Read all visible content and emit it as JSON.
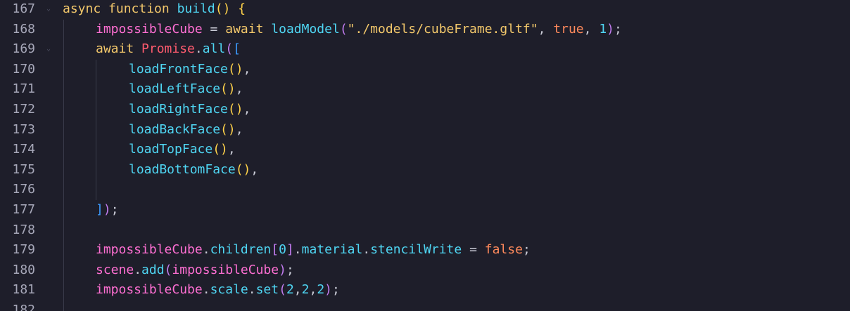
{
  "editor": {
    "lines": [
      {
        "num": "167",
        "tokens": [
          [
            "kw",
            "async"
          ],
          [
            "pn",
            " "
          ],
          [
            "kw",
            "function"
          ],
          [
            "pn",
            " "
          ],
          [
            "fn",
            "build"
          ],
          [
            "br1",
            "()"
          ],
          [
            "pn",
            " "
          ],
          [
            "br1",
            "{"
          ]
        ]
      },
      {
        "num": "168",
        "tokens": [
          [
            "var",
            "impossibleCube"
          ],
          [
            "pn",
            " = "
          ],
          [
            "kw",
            "await"
          ],
          [
            "pn",
            " "
          ],
          [
            "fn",
            "loadModel"
          ],
          [
            "br2",
            "("
          ],
          [
            "str",
            "\"./models/cubeFrame.gltf\""
          ],
          [
            "pn",
            ", "
          ],
          [
            "bool",
            "true"
          ],
          [
            "pn",
            ", "
          ],
          [
            "num",
            "1"
          ],
          [
            "br2",
            ")"
          ],
          [
            "pn",
            ";"
          ]
        ]
      },
      {
        "num": "169",
        "tokens": [
          [
            "kw",
            "await"
          ],
          [
            "pn",
            " "
          ],
          [
            "cls",
            "Promise"
          ],
          [
            "pn",
            "."
          ],
          [
            "fn",
            "all"
          ],
          [
            "br2",
            "("
          ],
          [
            "br3",
            "["
          ]
        ]
      },
      {
        "num": "170",
        "tokens": [
          [
            "fn",
            "loadFrontFace"
          ],
          [
            "br1",
            "()"
          ],
          [
            "pn",
            ","
          ]
        ]
      },
      {
        "num": "171",
        "tokens": [
          [
            "fn",
            "loadLeftFace"
          ],
          [
            "br1",
            "()"
          ],
          [
            "pn",
            ","
          ]
        ]
      },
      {
        "num": "172",
        "tokens": [
          [
            "fn",
            "loadRightFace"
          ],
          [
            "br1",
            "()"
          ],
          [
            "pn",
            ","
          ]
        ]
      },
      {
        "num": "173",
        "tokens": [
          [
            "fn",
            "loadBackFace"
          ],
          [
            "br1",
            "()"
          ],
          [
            "pn",
            ","
          ]
        ]
      },
      {
        "num": "174",
        "tokens": [
          [
            "fn",
            "loadTopFace"
          ],
          [
            "br1",
            "()"
          ],
          [
            "pn",
            ","
          ]
        ]
      },
      {
        "num": "175",
        "tokens": [
          [
            "fn",
            "loadBottomFace"
          ],
          [
            "br1",
            "()"
          ],
          [
            "pn",
            ","
          ]
        ]
      },
      {
        "num": "176",
        "tokens": []
      },
      {
        "num": "177",
        "tokens": [
          [
            "br3",
            "]"
          ],
          [
            "br2",
            ")"
          ],
          [
            "pn",
            ";"
          ]
        ]
      },
      {
        "num": "178",
        "tokens": []
      },
      {
        "num": "179",
        "tokens": [
          [
            "var",
            "impossibleCube"
          ],
          [
            "pn",
            "."
          ],
          [
            "fn",
            "children"
          ],
          [
            "br2",
            "["
          ],
          [
            "num",
            "0"
          ],
          [
            "br2",
            "]"
          ],
          [
            "pn",
            "."
          ],
          [
            "fn",
            "material"
          ],
          [
            "pn",
            "."
          ],
          [
            "fn",
            "stencilWrite"
          ],
          [
            "pn",
            " = "
          ],
          [
            "bool",
            "false"
          ],
          [
            "pn",
            ";"
          ]
        ]
      },
      {
        "num": "180",
        "tokens": [
          [
            "var",
            "scene"
          ],
          [
            "pn",
            "."
          ],
          [
            "fn",
            "add"
          ],
          [
            "br2",
            "("
          ],
          [
            "var",
            "impossibleCube"
          ],
          [
            "br2",
            ")"
          ],
          [
            "pn",
            ";"
          ]
        ]
      },
      {
        "num": "181",
        "tokens": [
          [
            "var",
            "impossibleCube"
          ],
          [
            "pn",
            "."
          ],
          [
            "fn",
            "scale"
          ],
          [
            "pn",
            "."
          ],
          [
            "fn",
            "set"
          ],
          [
            "br2",
            "("
          ],
          [
            "num",
            "2"
          ],
          [
            "pn",
            ","
          ],
          [
            "num",
            "2"
          ],
          [
            "pn",
            ","
          ],
          [
            "num",
            "2"
          ],
          [
            "br2",
            ")"
          ],
          [
            "pn",
            ";"
          ]
        ]
      },
      {
        "num": "182",
        "tokens": []
      }
    ]
  }
}
